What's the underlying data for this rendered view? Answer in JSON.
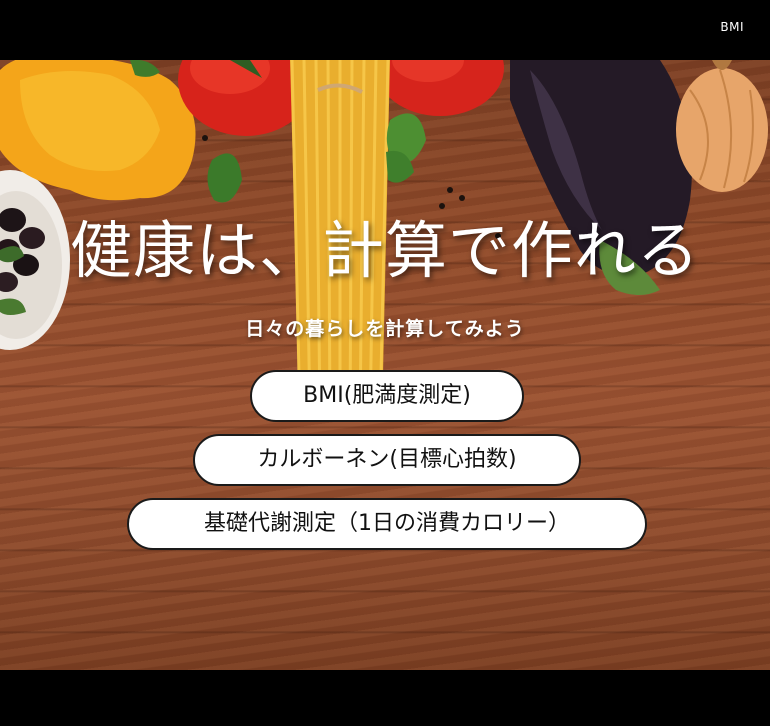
{
  "nav": {
    "bmi_link": "BMI"
  },
  "hero": {
    "headline": "健康は、計算で作れる",
    "subtitle": "日々の暮らしを計算してみよう"
  },
  "buttons": [
    {
      "label": "BMI(肥満度測定)"
    },
    {
      "label": "カルボーネン(目標心拍数)"
    },
    {
      "label": "基礎代謝測定（1日の消費カロリー）"
    }
  ],
  "colors": {
    "bar": "#000000",
    "wood": "#8f4a2a",
    "button_bg": "#ffffff",
    "button_border": "#1a1a1a",
    "text_light": "#ffffff"
  }
}
